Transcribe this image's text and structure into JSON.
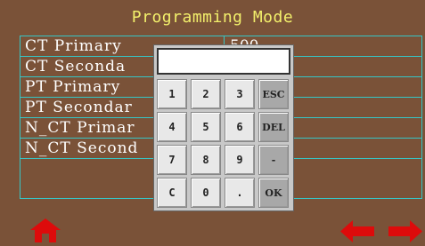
{
  "header": {
    "title": "Programming Mode"
  },
  "params": [
    {
      "label": "CT Primary",
      "value": "500"
    },
    {
      "label": "CT Seconda",
      "value": ""
    },
    {
      "label": "PT Primary",
      "value": ""
    },
    {
      "label": "PT Secondar",
      "value": ""
    },
    {
      "label": "N_CT Primar",
      "value": ""
    },
    {
      "label": "N_CT Second",
      "value": ""
    },
    {
      "label": "",
      "value": ""
    }
  ],
  "keypad": {
    "display": "",
    "keys": [
      "1",
      "2",
      "3",
      "ESC",
      "4",
      "5",
      "6",
      "DEL",
      "7",
      "8",
      "9",
      "-",
      "C",
      "0",
      ".",
      "OK"
    ]
  },
  "nav": {
    "home_icon": "home-icon",
    "prev_icon": "arrow-left-icon",
    "next_icon": "arrow-right-icon"
  },
  "colors": {
    "background": "#7a5238",
    "title": "#f2ef6b",
    "grid": "#36c6c6",
    "nav_icons": "#dd0b0b"
  }
}
